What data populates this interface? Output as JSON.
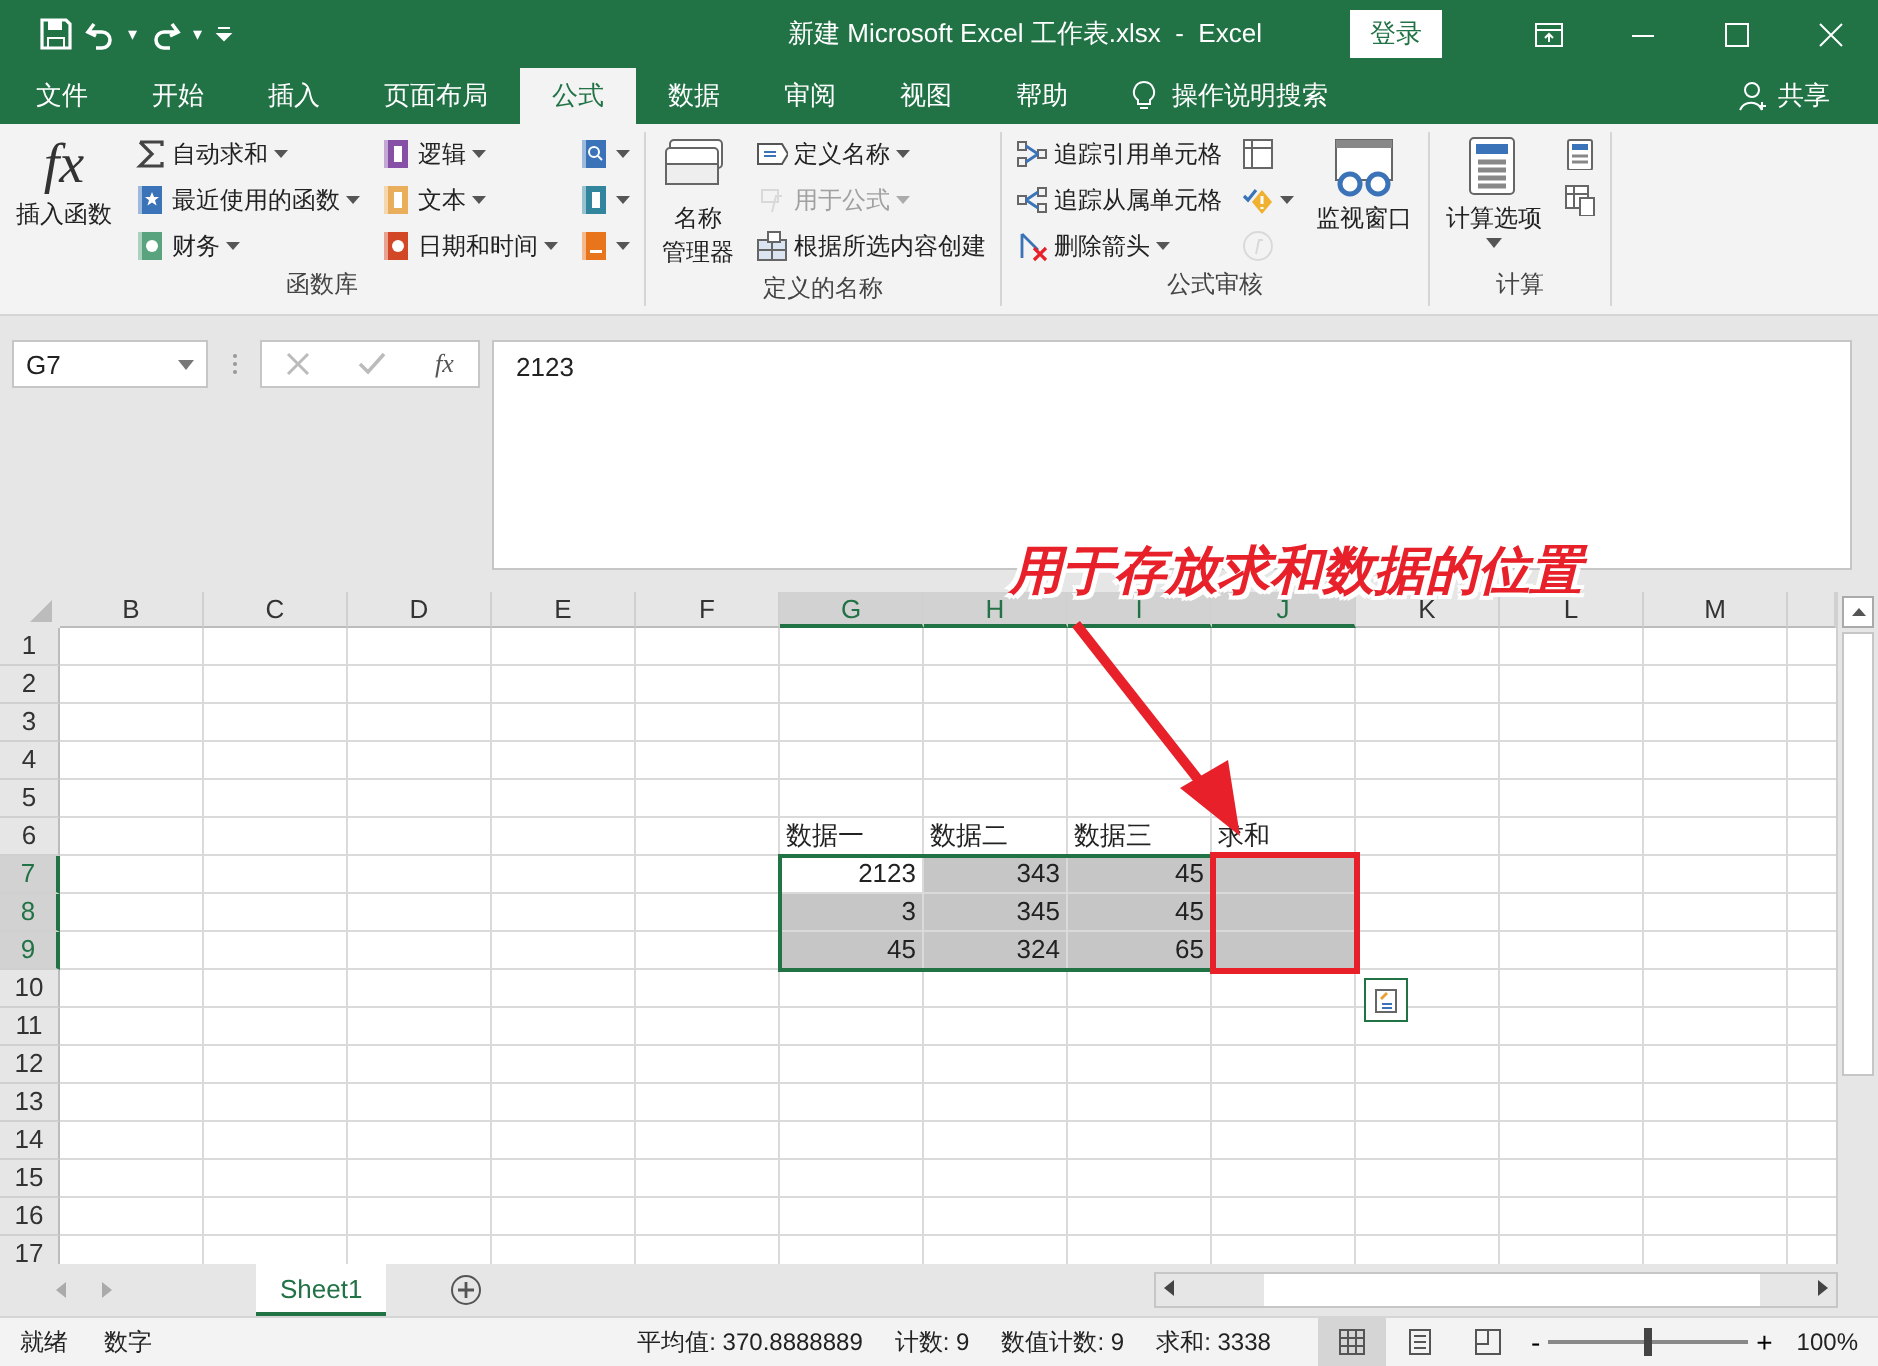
{
  "title_bar": {
    "title": "新建 Microsoft Excel 工作表.xlsx  -  Excel",
    "login": "登录",
    "qat_dropdowns": [
      "▾",
      "▾"
    ]
  },
  "menu_tabs": [
    {
      "label": "文件",
      "selected": false
    },
    {
      "label": "开始",
      "selected": false
    },
    {
      "label": "插入",
      "selected": false
    },
    {
      "label": "页面布局",
      "selected": false
    },
    {
      "label": "公式",
      "selected": true
    },
    {
      "label": "数据",
      "selected": false
    },
    {
      "label": "审阅",
      "selected": false
    },
    {
      "label": "视图",
      "selected": false
    },
    {
      "label": "帮助",
      "selected": false
    }
  ],
  "tell_me": "操作说明搜索",
  "share": "共享",
  "ribbon": [
    {
      "label": "函数库",
      "columns": [
        {
          "kind": "large",
          "items": [
            {
              "lines": [
                "插入函数"
              ],
              "glyph": "fx",
              "dropdown": false,
              "disabled": false
            }
          ]
        },
        {
          "kind": "stack",
          "items": [
            {
              "label": "自动求和",
              "dropdown": true,
              "disabled": false
            },
            {
              "label": "最近使用的函数",
              "dropdown": true,
              "disabled": false
            },
            {
              "label": "财务",
              "dropdown": true,
              "disabled": false
            }
          ]
        },
        {
          "kind": "stack",
          "items": [
            {
              "label": "逻辑",
              "dropdown": true,
              "disabled": false
            },
            {
              "label": "文本",
              "dropdown": true,
              "disabled": false
            },
            {
              "label": "日期和时间",
              "dropdown": true,
              "disabled": false
            }
          ]
        },
        {
          "kind": "stack",
          "items": [
            {
              "dropdown": true,
              "disabled": false
            },
            {
              "dropdown": true,
              "disabled": false
            },
            {
              "dropdown": true,
              "disabled": false
            }
          ]
        }
      ]
    },
    {
      "label": "定义的名称",
      "columns": [
        {
          "kind": "large",
          "items": [
            {
              "lines": [
                "名称",
                "管理器"
              ],
              "dropdown": false,
              "disabled": false
            }
          ]
        },
        {
          "kind": "stack",
          "items": [
            {
              "label": "定义名称",
              "dropdown": true,
              "disabled": false
            },
            {
              "label": "用于公式",
              "dropdown": true,
              "disabled": true
            },
            {
              "label": "根据所选内容创建",
              "dropdown": false,
              "disabled": false
            }
          ]
        }
      ]
    },
    {
      "label": "公式审核",
      "columns": [
        {
          "kind": "stack",
          "items": [
            {
              "label": "追踪引用单元格",
              "dropdown": false,
              "disabled": false
            },
            {
              "label": "追踪从属单元格",
              "dropdown": false,
              "disabled": false
            },
            {
              "label": "删除箭头",
              "dropdown": true,
              "disabled": false
            }
          ]
        },
        {
          "kind": "stack",
          "items": [
            {
              "dropdown": false,
              "disabled": false
            },
            {
              "dropdown": true,
              "disabled": false
            },
            {
              "dropdown": false,
              "disabled": true
            }
          ]
        },
        {
          "kind": "large",
          "items": [
            {
              "lines": [
                "监视窗口"
              ],
              "dropdown": false,
              "disabled": false
            }
          ]
        }
      ]
    },
    {
      "label": "计算",
      "columns": [
        {
          "kind": "large",
          "items": [
            {
              "lines": [
                "计算选项"
              ],
              "dropdown": true,
              "disabled": false
            }
          ]
        },
        {
          "kind": "stack",
          "items": [
            {
              "dropdown": false,
              "disabled": false
            },
            {
              "dropdown": false,
              "disabled": false
            }
          ]
        }
      ]
    }
  ],
  "formula_bar": {
    "name_box": "G7",
    "fx": "fx",
    "value": "2123"
  },
  "sheet": {
    "columns": [
      {
        "label": "B",
        "selected": false
      },
      {
        "label": "C",
        "selected": false
      },
      {
        "label": "D",
        "selected": false
      },
      {
        "label": "E",
        "selected": false
      },
      {
        "label": "F",
        "selected": false
      },
      {
        "label": "G",
        "selected": true
      },
      {
        "label": "H",
        "selected": true
      },
      {
        "label": "I",
        "selected": true
      },
      {
        "label": "J",
        "selected": true
      },
      {
        "label": "K",
        "selected": false
      },
      {
        "label": "L",
        "selected": false
      },
      {
        "label": "M",
        "selected": false
      }
    ],
    "rows": [
      {
        "label": "1",
        "selected": false
      },
      {
        "label": "2",
        "selected": false
      },
      {
        "label": "3",
        "selected": false
      },
      {
        "label": "4",
        "selected": false
      },
      {
        "label": "5",
        "selected": false
      },
      {
        "label": "6",
        "selected": false
      },
      {
        "label": "7",
        "selected": true
      },
      {
        "label": "8",
        "selected": true
      },
      {
        "label": "9",
        "selected": true
      },
      {
        "label": "10",
        "selected": false
      },
      {
        "label": "11",
        "selected": false
      },
      {
        "label": "12",
        "selected": false
      },
      {
        "label": "13",
        "selected": false
      },
      {
        "label": "14",
        "selected": false
      },
      {
        "label": "15",
        "selected": false
      },
      {
        "label": "16",
        "selected": false
      },
      {
        "label": "17",
        "selected": false
      }
    ],
    "table": {
      "header": [
        "数据一",
        "数据二",
        "数据三",
        "求和"
      ],
      "rows": [
        [
          {
            "value": "2123",
            "selected": false
          },
          {
            "value": "343",
            "selected": true
          },
          {
            "value": "45",
            "selected": true
          },
          {
            "selected": true
          }
        ],
        [
          {
            "value": "3",
            "selected": true
          },
          {
            "value": "345",
            "selected": true
          },
          {
            "value": "45",
            "selected": true
          },
          {
            "selected": true
          }
        ],
        [
          {
            "value": "45",
            "selected": true
          },
          {
            "value": "324",
            "selected": true
          },
          {
            "value": "65",
            "selected": true
          },
          {
            "selected": true
          }
        ]
      ]
    }
  },
  "annotation": {
    "text": "用于存放求和数据的位置"
  },
  "sheet_tabs": [
    {
      "label": "Sheet1",
      "selected": true
    }
  ],
  "status_bar": {
    "mode": "就绪",
    "num": "数字",
    "stats": [
      "平均值: 370.8888889",
      "计数: 9",
      "数值计数: 9",
      "求和: 3338"
    ],
    "views": [
      {
        "selected": true
      },
      {
        "selected": false
      },
      {
        "selected": false
      }
    ],
    "zoom_out": "-",
    "zoom_in": "+",
    "zoom": {
      "level": 0.5
    },
    "zoom_text": "100%"
  }
}
